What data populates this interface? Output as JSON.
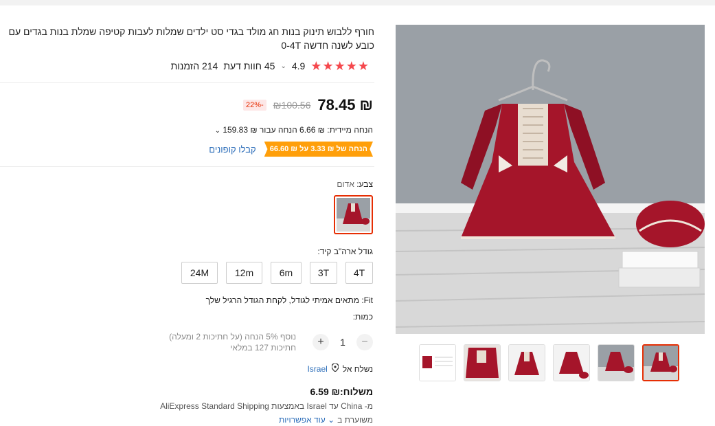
{
  "product": {
    "title": "חורף ללבוש תינוק בנות חג מולד בגדי סט ילדים שמלות לעבות קטיפה שמלת בנות בגדים עם כובע לשנה חדשה 0-4T",
    "rating": {
      "stars": 5,
      "value": "4.9",
      "reviews": "45 חוות דעת",
      "orders": "214 הזמנות"
    },
    "price": {
      "current": "₪ 78.45",
      "original": "₪100.56",
      "discount": "-22%"
    },
    "instant_savings": "הנחה מיידית: ₪ 6.66 הנחה עבור ₪ 159.83",
    "coupon": {
      "tag": "הנחה של ₪ 3.33 על ₪ 66.60",
      "link": "קבלו קופונים"
    },
    "color": {
      "label": "צבע:",
      "value": "אדום"
    },
    "size": {
      "label": "גודל ארה\"ב קיד:",
      "options": [
        "4T",
        "3T",
        "6m",
        "12m",
        "24M"
      ]
    },
    "fit": "Fit: מתאים אמיתי לגודל, לקחת הגודל הרגיל שלך",
    "quantity": {
      "label": "כמות:",
      "value": "1",
      "minus": "−",
      "plus": "+",
      "note_discount": "נוסף 5% הנחה (על חתיכות 2 ומעלה)",
      "note_stock": "חתיכות 127 במלאי"
    },
    "shipping": {
      "ship_to_label": "נשלח אל",
      "country": "Israel",
      "price": "משלוח:₪ 6.59",
      "method": "מ- China עד Israel באמצעות AliExpress Standard Shipping",
      "estimate": "משוערת ב",
      "more_options": "עוד אפשרויות"
    }
  },
  "colors": {
    "accent": "#e62e04",
    "star": "#f5484d",
    "coupon": "#ff9f0a",
    "link": "#2e6fba"
  }
}
